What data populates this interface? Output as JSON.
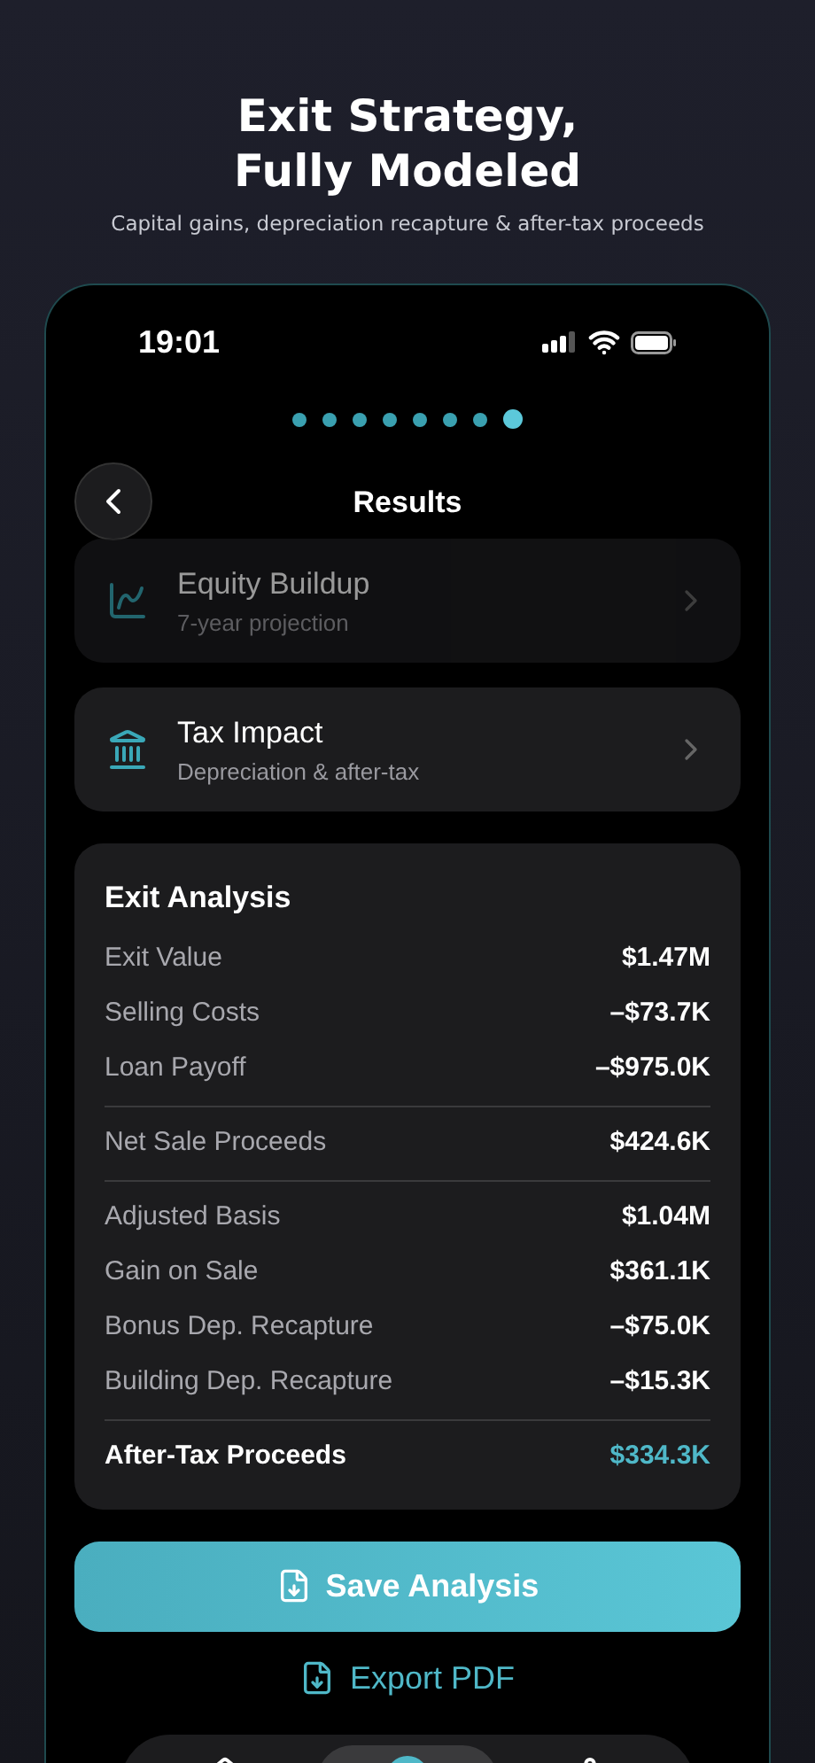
{
  "hero": {
    "title": "Exit Strategy,\nFully Modeled",
    "subtitle": "Capital gains, depreciation recapture & after-tax proceeds"
  },
  "status_bar": {
    "time": "19:01"
  },
  "page_dots": [
    {
      "selected": false
    },
    {
      "selected": false
    },
    {
      "selected": false
    },
    {
      "selected": false
    },
    {
      "selected": false
    },
    {
      "selected": false
    },
    {
      "selected": false
    },
    {
      "selected": true
    }
  ],
  "header": {
    "title": "Results"
  },
  "nav_cards": [
    {
      "title": "Equity Buildup",
      "subtitle": "7-year projection",
      "dimmed": true
    },
    {
      "title": "Tax Impact",
      "subtitle": "Depreciation & after-tax",
      "dimmed": false
    }
  ],
  "exit_analysis": {
    "title": "Exit Analysis",
    "sections": [
      [
        {
          "label": "Exit Value",
          "value": "$1.47M",
          "kind": "row"
        },
        {
          "label": "Selling Costs",
          "value": "–$73.7K",
          "kind": "row"
        },
        {
          "label": "Loan Payoff",
          "value": "–$975.0K",
          "kind": "row"
        }
      ],
      [
        {
          "label": "Net Sale Proceeds",
          "value": "$424.6K",
          "kind": "row"
        }
      ],
      [
        {
          "label": "Adjusted Basis",
          "value": "$1.04M",
          "kind": "row"
        },
        {
          "label": "Gain on Sale",
          "value": "$361.1K",
          "kind": "row"
        },
        {
          "label": "Bonus Dep. Recapture",
          "value": "–$75.0K",
          "kind": "row"
        },
        {
          "label": "Building Dep. Recapture",
          "value": "–$15.3K",
          "kind": "row"
        }
      ],
      [
        {
          "label": "After-Tax Proceeds",
          "value": "$334.3K",
          "kind": "total"
        }
      ]
    ]
  },
  "save_button": "Save Analysis",
  "export_link": "Export PDF",
  "tab_bar": [
    {
      "selected": false
    },
    {
      "selected": true
    },
    {
      "selected": false
    }
  ]
}
